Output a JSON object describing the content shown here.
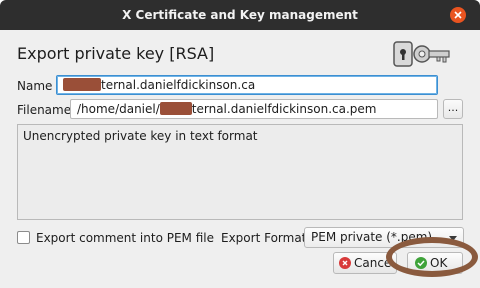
{
  "window": {
    "title": "X Certificate and Key management"
  },
  "dialog": {
    "heading": "Export private key [RSA]",
    "name_label": "Name",
    "name_value_suffix": "ternal.danielfdickinson.ca",
    "filename_label": "Filename",
    "filename_value_prefix": "/home/daniel/",
    "filename_value_suffix": "ternal.danielfdickinson.ca.pem",
    "browse_label": "...",
    "description": "Unencrypted private key in text format",
    "export_comment_label": "Export comment into PEM file",
    "export_comment_checked": false,
    "format_label": "Export Format",
    "format_value": "PEM private (*.pem)",
    "cancel_label": "Cance",
    "ok_label": "OK"
  },
  "icons": {
    "close": "close-icon",
    "key": "key-icon",
    "cancel": "cancel-icon",
    "ok": "check-icon"
  },
  "colors": {
    "titlebar": "#2e2e2e",
    "close": "#e95420",
    "cancel_icon": "#d83b3b",
    "ok_icon": "#3fa33a",
    "annotation_ring": "#8a5a3e",
    "redaction": "#9a4f38"
  }
}
